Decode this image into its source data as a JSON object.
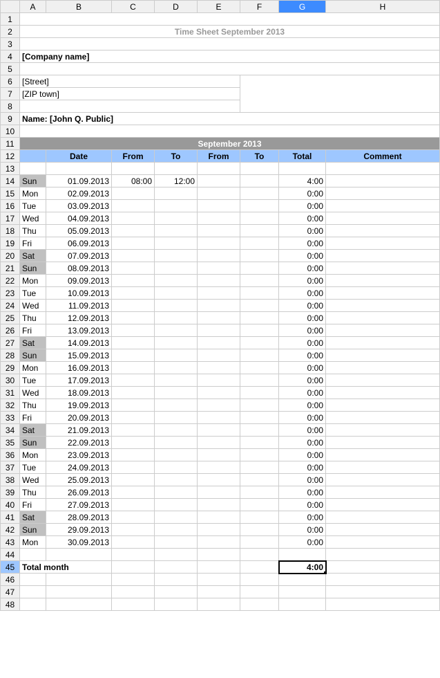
{
  "columns": [
    "A",
    "B",
    "C",
    "D",
    "E",
    "F",
    "G",
    "H"
  ],
  "selected_col": "G",
  "selected_row": 45,
  "title": "Time Sheet September 2013",
  "company": "[Company name]",
  "street": "[Street]",
  "zip": "[ZIP town]",
  "name_label": "Name: [John Q. Public]",
  "month_header": "September 2013",
  "col_headers": {
    "date": "Date",
    "from1": "From",
    "to1": "To",
    "from2": "From",
    "to2": "To",
    "total": "Total",
    "comment": "Comment"
  },
  "rows": [
    {
      "r": 14,
      "day": "Sun",
      "date": "01.09.2013",
      "from1": "08:00",
      "to1": "12:00",
      "total": "4:00",
      "wk": true
    },
    {
      "r": 15,
      "day": "Mon",
      "date": "02.09.2013",
      "total": "0:00"
    },
    {
      "r": 16,
      "day": "Tue",
      "date": "03.09.2013",
      "total": "0:00"
    },
    {
      "r": 17,
      "day": "Wed",
      "date": "04.09.2013",
      "total": "0:00"
    },
    {
      "r": 18,
      "day": "Thu",
      "date": "05.09.2013",
      "total": "0:00"
    },
    {
      "r": 19,
      "day": "Fri",
      "date": "06.09.2013",
      "total": "0:00"
    },
    {
      "r": 20,
      "day": "Sat",
      "date": "07.09.2013",
      "total": "0:00",
      "wk": true
    },
    {
      "r": 21,
      "day": "Sun",
      "date": "08.09.2013",
      "total": "0:00",
      "wk": true
    },
    {
      "r": 22,
      "day": "Mon",
      "date": "09.09.2013",
      "total": "0:00"
    },
    {
      "r": 23,
      "day": "Tue",
      "date": "10.09.2013",
      "total": "0:00"
    },
    {
      "r": 24,
      "day": "Wed",
      "date": "11.09.2013",
      "total": "0:00"
    },
    {
      "r": 25,
      "day": "Thu",
      "date": "12.09.2013",
      "total": "0:00"
    },
    {
      "r": 26,
      "day": "Fri",
      "date": "13.09.2013",
      "total": "0:00"
    },
    {
      "r": 27,
      "day": "Sat",
      "date": "14.09.2013",
      "total": "0:00",
      "wk": true
    },
    {
      "r": 28,
      "day": "Sun",
      "date": "15.09.2013",
      "total": "0:00",
      "wk": true
    },
    {
      "r": 29,
      "day": "Mon",
      "date": "16.09.2013",
      "total": "0:00"
    },
    {
      "r": 30,
      "day": "Tue",
      "date": "17.09.2013",
      "total": "0:00"
    },
    {
      "r": 31,
      "day": "Wed",
      "date": "18.09.2013",
      "total": "0:00"
    },
    {
      "r": 32,
      "day": "Thu",
      "date": "19.09.2013",
      "total": "0:00"
    },
    {
      "r": 33,
      "day": "Fri",
      "date": "20.09.2013",
      "total": "0:00"
    },
    {
      "r": 34,
      "day": "Sat",
      "date": "21.09.2013",
      "total": "0:00",
      "wk": true
    },
    {
      "r": 35,
      "day": "Sun",
      "date": "22.09.2013",
      "total": "0:00",
      "wk": true
    },
    {
      "r": 36,
      "day": "Mon",
      "date": "23.09.2013",
      "total": "0:00"
    },
    {
      "r": 37,
      "day": "Tue",
      "date": "24.09.2013",
      "total": "0:00"
    },
    {
      "r": 38,
      "day": "Wed",
      "date": "25.09.2013",
      "total": "0:00"
    },
    {
      "r": 39,
      "day": "Thu",
      "date": "26.09.2013",
      "total": "0:00"
    },
    {
      "r": 40,
      "day": "Fri",
      "date": "27.09.2013",
      "total": "0:00"
    },
    {
      "r": 41,
      "day": "Sat",
      "date": "28.09.2013",
      "total": "0:00",
      "wk": true
    },
    {
      "r": 42,
      "day": "Sun",
      "date": "29.09.2013",
      "total": "0:00",
      "wk": true
    },
    {
      "r": 43,
      "day": "Mon",
      "date": "30.09.2013",
      "total": "0:00"
    }
  ],
  "total_month_label": "Total month",
  "total_month_value": "4:00"
}
